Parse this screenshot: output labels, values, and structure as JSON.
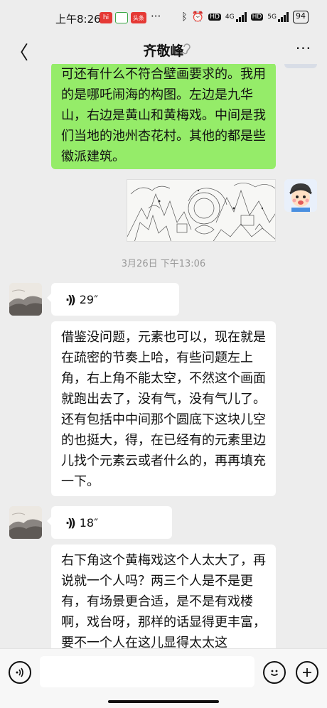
{
  "status": {
    "time": "上午8:26",
    "app_badges": [
      "hi",
      "",
      "头条"
    ],
    "more": "···",
    "network_hd1": "HD",
    "network_4g": "4G",
    "network_hd2": "HD",
    "network_5g": "5G",
    "battery": "94"
  },
  "header": {
    "back": "〈",
    "title": "齐敬峰",
    "more": "···"
  },
  "messages": {
    "sent_text": "可还有什么不符合壁画要求的。我用的是哪吒闹海的构图。左边是九华山，右边是黄山和黄梅戏。中间是我们当地的池州杏花村。其他的都是些徽派建筑。",
    "timestamp": "3月26日 下午13:06",
    "voice1_duration": "29″",
    "text1": "借鉴没问题，元素也可以，现在就是在疏密的节奏上哈，有些问题左上角，右上角不能太空，不然这个画面就跑出去了，没有气，没有气儿了。还有包括中中间那个圆底下这块儿空的也挺大，得，在已经有的元素里边儿找个元素云或者什么的，再再填充一下。",
    "voice2_duration": "18″",
    "text2": "右下角这个黄梅戏这个人太大了，再说就一个人吗？两三个人是不是更有，有场景更合适，是不是有戏楼啊，戏台呀，那样的话显得更丰富，要不一个人在这儿显得太太这"
  },
  "colors": {
    "sent_bubble": "#95ec69",
    "received_bubble": "#ffffff",
    "background": "#ededed"
  },
  "icons": [
    "chevron-left-icon",
    "ear-icon",
    "more-icon",
    "voice-wave-icon",
    "voice-input-icon",
    "emoji-icon",
    "add-icon"
  ]
}
